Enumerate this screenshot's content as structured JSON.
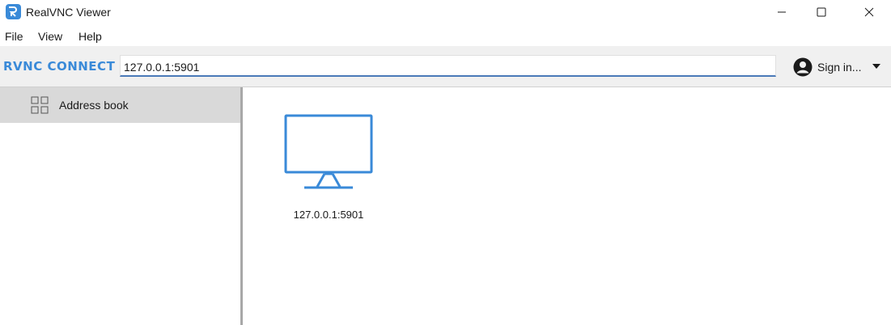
{
  "window": {
    "title": "RealVNC Viewer",
    "logo_icon": "realvnc-logo-icon",
    "controls": [
      "minimize-icon",
      "maximize-icon",
      "close-icon"
    ]
  },
  "menu": {
    "file": "File",
    "view": "View",
    "help": "Help"
  },
  "toolbar": {
    "brand": "RVNC CONNECT",
    "address_value": "127.0.0.1:5901",
    "signin_label": "Sign in...",
    "accent_color": "#3a8ad8"
  },
  "sidebar": {
    "items": [
      {
        "label": "Address book",
        "icon": "grid-icon",
        "selected": true
      }
    ]
  },
  "main": {
    "connections": [
      {
        "label": "127.0.0.1:5901",
        "icon": "monitor-icon"
      }
    ]
  }
}
